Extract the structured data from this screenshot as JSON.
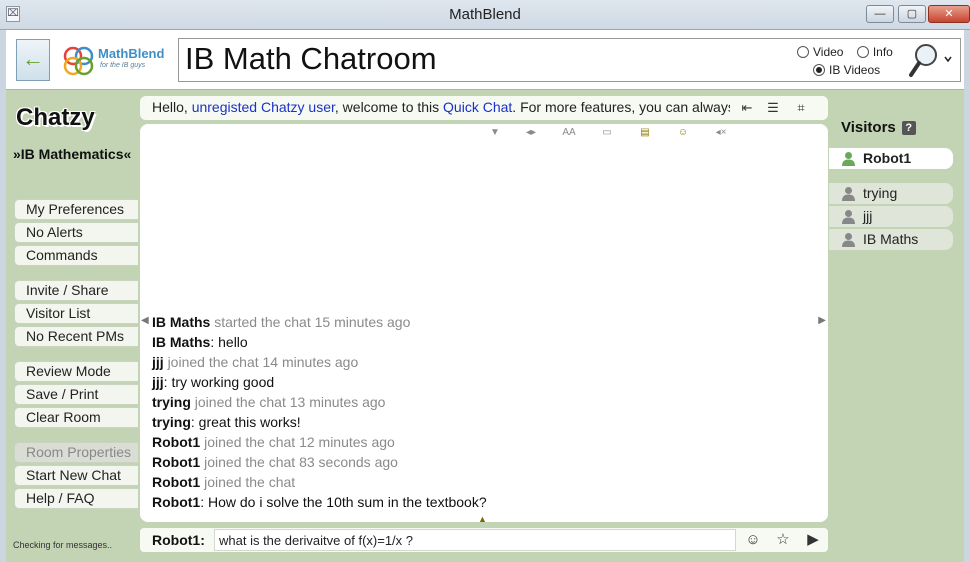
{
  "window": {
    "title": "MathBlend",
    "minimize": "—",
    "maximize": "▢",
    "close": "✕"
  },
  "header": {
    "back_icon": "←",
    "logo_text": "MathBlend",
    "logo_subtitle": "for the IB guys",
    "room_title": "IB Math Chatroom",
    "radios": [
      {
        "label": "Video",
        "checked": false
      },
      {
        "label": "Info",
        "checked": false
      },
      {
        "label": "IB Videos",
        "checked": true
      }
    ]
  },
  "sidebar": {
    "brand": "Chatzy",
    "room_name": "»IB Mathematics«",
    "menu": [
      {
        "label": "My Preferences",
        "disabled": false
      },
      {
        "label": "No Alerts",
        "disabled": false
      },
      {
        "label": "Commands",
        "disabled": false
      },
      {
        "label": "Invite / Share",
        "disabled": false
      },
      {
        "label": "Visitor List",
        "disabled": false
      },
      {
        "label": "No Recent PMs",
        "disabled": false
      },
      {
        "label": "Review Mode",
        "disabled": false
      },
      {
        "label": "Save / Print",
        "disabled": false
      },
      {
        "label": "Clear Room",
        "disabled": false
      },
      {
        "label": "Room Properties",
        "disabled": true
      },
      {
        "label": "Start New Chat",
        "disabled": false
      },
      {
        "label": "Help / FAQ",
        "disabled": false
      }
    ],
    "status": "Checking for messages.."
  },
  "welcome": {
    "prefix": "Hello, ",
    "user_link": "unregisted Chatzy user",
    "middle": ", welcome to this ",
    "quick_link": "Quick Chat",
    "suffix": ". For more features, you can always"
  },
  "messages": [
    {
      "user": "IB Maths",
      "sep": " ",
      "text": "started the chat 15 minutes ago",
      "system": true
    },
    {
      "user": "IB Maths",
      "sep": ": ",
      "text": "hello",
      "system": false
    },
    {
      "user": "jjj",
      "sep": " ",
      "text": "joined the chat 14 minutes ago",
      "system": true
    },
    {
      "user": "jjj",
      "sep": ": ",
      "text": "try working good",
      "system": false
    },
    {
      "user": "trying",
      "sep": " ",
      "text": "joined the chat 13 minutes ago",
      "system": true
    },
    {
      "user": "trying",
      "sep": ": ",
      "text": "great this works!",
      "system": false
    },
    {
      "user": "Robot1",
      "sep": " ",
      "text": "joined the chat 12 minutes ago",
      "system": true
    },
    {
      "user": "Robot1",
      "sep": " ",
      "text": "joined the chat 83 seconds ago",
      "system": true
    },
    {
      "user": "Robot1",
      "sep": " ",
      "text": "joined the chat",
      "system": true
    },
    {
      "user": "Robot1",
      "sep": ": ",
      "text": "How do i solve the 10th sum in the textbook?",
      "system": false
    }
  ],
  "input": {
    "user": "Robot1:",
    "value": "what is the derivaitve of f(x)=1/x ?"
  },
  "visitors": {
    "heading": "Visitors",
    "help": "?",
    "list": [
      {
        "name": "Robot1",
        "self": true
      },
      {
        "name": "trying",
        "self": false
      },
      {
        "name": "jjj",
        "self": false
      },
      {
        "name": "IB Maths",
        "self": false
      }
    ]
  },
  "colors": {
    "background": "#c3d4b4",
    "link": "#1a32c8",
    "system_text": "#8a8a8a"
  }
}
